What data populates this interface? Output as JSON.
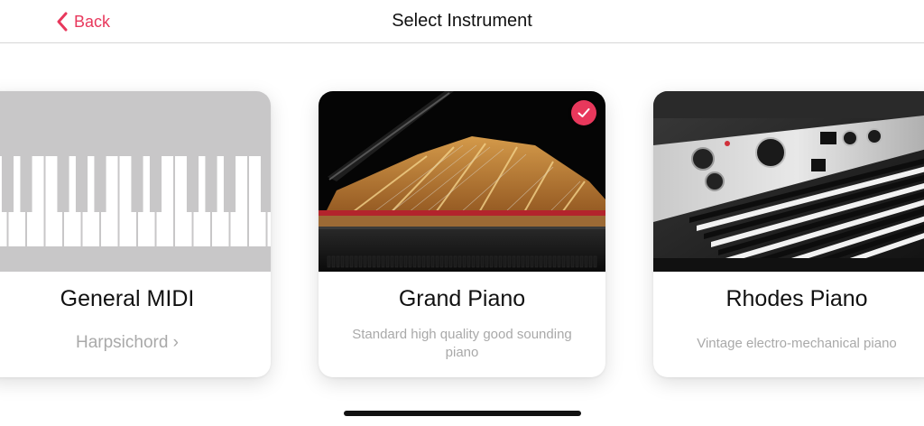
{
  "nav": {
    "back_label": "Back",
    "title": "Select Instrument"
  },
  "instruments": [
    {
      "name": "General MIDI",
      "subtitle": "Harpsichord ›",
      "image": "keyboard-illustration",
      "selected": false
    },
    {
      "name": "Grand Piano",
      "description": "Standard high quality good sounding piano",
      "image": "grand-piano-photo",
      "selected": true
    },
    {
      "name": "Rhodes Piano",
      "description": "Vintage electro-mechanical piano",
      "image": "rhodes-piano-photo",
      "selected": false
    }
  ],
  "colors": {
    "accent": "#e8385c",
    "secondary_text": "#a9a9a9"
  },
  "icons": [
    "chevron-left-icon",
    "checkmark-icon"
  ]
}
